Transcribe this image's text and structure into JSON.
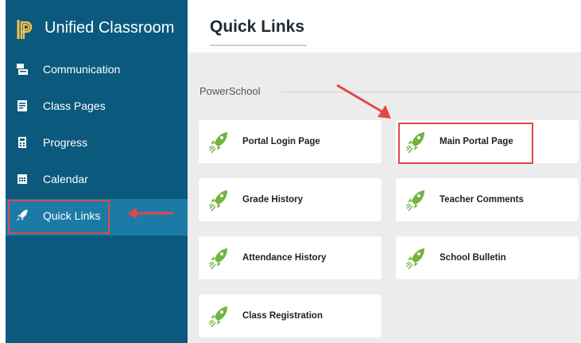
{
  "app": {
    "title": "Unified Classroom"
  },
  "sidebar": {
    "items": [
      {
        "label": "Communication",
        "icon": "communication-icon"
      },
      {
        "label": "Class Pages",
        "icon": "class-pages-icon"
      },
      {
        "label": "Progress",
        "icon": "progress-icon"
      },
      {
        "label": "Calendar",
        "icon": "calendar-icon"
      },
      {
        "label": "Quick Links",
        "icon": "rocket-icon",
        "active": true
      }
    ]
  },
  "main": {
    "title": "Quick Links",
    "section": "PowerSchool",
    "links": [
      {
        "label": "Portal Login Page"
      },
      {
        "label": "Main Portal Page"
      },
      {
        "label": "Grade History"
      },
      {
        "label": "Teacher Comments"
      },
      {
        "label": "Attendance History"
      },
      {
        "label": "School Bulletin"
      },
      {
        "label": "Class Registration"
      }
    ]
  },
  "colors": {
    "sidebar": "#0b5a7e",
    "sidebar_active": "#1b7aa6",
    "rocket": "#72b43e",
    "highlight": "#e04848"
  }
}
